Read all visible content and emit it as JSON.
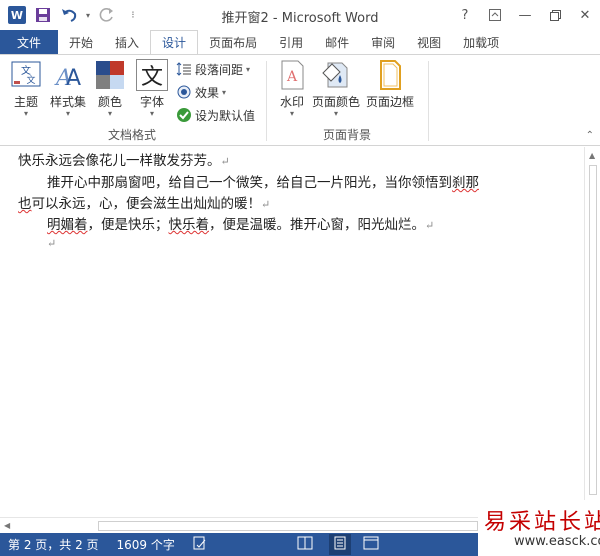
{
  "titlebar": {
    "title": "推开窗2 - Microsoft Word",
    "help": "?",
    "app_logo": "W"
  },
  "tabs": [
    {
      "label": "文件"
    },
    {
      "label": "开始"
    },
    {
      "label": "插入"
    },
    {
      "label": "设计"
    },
    {
      "label": "页面布局"
    },
    {
      "label": "引用"
    },
    {
      "label": "邮件"
    },
    {
      "label": "审阅"
    },
    {
      "label": "视图"
    },
    {
      "label": "加载项"
    }
  ],
  "ribbon": {
    "doc_format_group": {
      "label": "文档格式",
      "theme": "主题",
      "styleset": "样式集",
      "colors": "颜色",
      "fonts": "字体",
      "fonts_icon_char": "文",
      "paragraph_spacing": "段落间距",
      "effects": "效果",
      "set_default": "设为默认值"
    },
    "page_background_group": {
      "label": "页面背景",
      "watermark": "水印",
      "page_color": "页面颜色",
      "page_borders": "页面边框"
    }
  },
  "document": {
    "line1": "快乐永远会像花儿一样散发芬芳。",
    "line2_a": "推开心中那扇窗吧，给自己一个微笑，给自己一片阳光，当你领悟到",
    "line2_b": "刹那",
    "line3_a": "也",
    "line3_b": "可以永远，心，便会滋生出灿灿的暖！",
    "line4_a": "明媚着",
    "line4_b": "，便是快乐；",
    "line4_c": "快乐着",
    "line4_d": "，便是温暖。推开心窗，阳光灿烂。",
    "para_mark": "↵"
  },
  "statusbar": {
    "pages": "第 2 页，共 2 页",
    "words": "1609 个字"
  },
  "watermark": {
    "brand": "易采站长站",
    "url": "www.easck.com"
  },
  "colors": {
    "accent": "#2b579a",
    "squiggle": "#d33333",
    "watermark_red": "#c40000"
  }
}
